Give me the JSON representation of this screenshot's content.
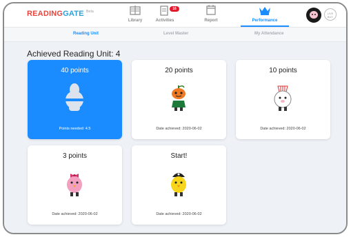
{
  "app": {
    "logo_part1": "READING",
    "logo_part2": "GATE",
    "logo_beta": "Beta"
  },
  "nav": {
    "items": [
      {
        "label": "Library",
        "icon": "library-icon"
      },
      {
        "label": "Activities",
        "icon": "activities-icon",
        "badge": "16"
      },
      {
        "label": "Report",
        "icon": "report-icon"
      },
      {
        "label": "Performance",
        "icon": "crown-icon",
        "active": true
      }
    ],
    "live_button": "LIVE BUY",
    "accent": "#1a8cff"
  },
  "subtabs": [
    {
      "label": "Reading Unit",
      "active": true
    },
    {
      "label": "Level Master"
    },
    {
      "label": "My Attendance"
    }
  ],
  "main": {
    "heading": "Achieved Reading Unit: 4",
    "cards": [
      {
        "points": "40 points",
        "footer": "Points needed: 4.5",
        "locked": true,
        "character": "locked-silhouette"
      },
      {
        "points": "20 points",
        "footer": "Date achieved: 2020-06-02",
        "character": "pumpkin-character"
      },
      {
        "points": "10 points",
        "footer": "Date achieved: 2020-06-02",
        "character": "sheep-character"
      },
      {
        "points": "3 points",
        "footer": "Date achieved: 2020-06-02",
        "character": "pink-bird-character"
      },
      {
        "points": "Start!",
        "footer": "Date achieved: 2020-06-02",
        "character": "pirate-chick-character"
      }
    ]
  }
}
